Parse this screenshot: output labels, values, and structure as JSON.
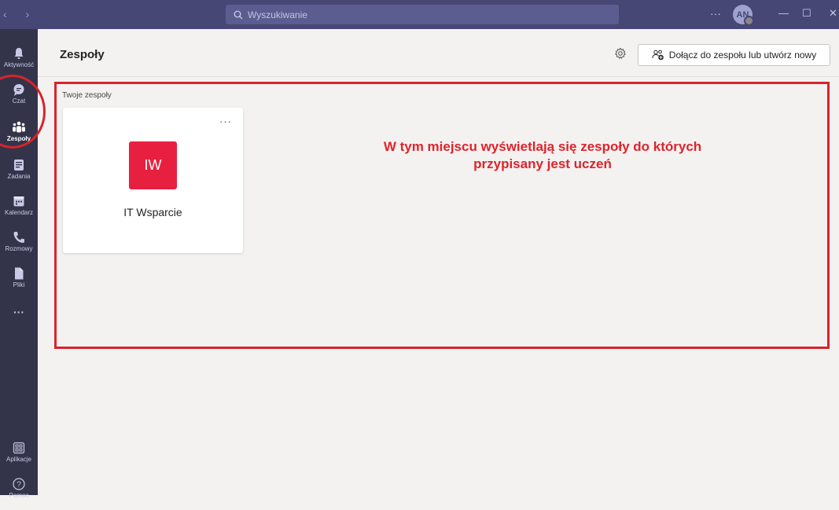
{
  "titlebar": {
    "search_placeholder": "Wyszukiwanie",
    "more": "···",
    "avatar_initials": "AN"
  },
  "rail": {
    "items": [
      {
        "label": "Aktywność",
        "icon": "bell-icon"
      },
      {
        "label": "Czat",
        "icon": "chat-icon"
      },
      {
        "label": "Zespoły",
        "icon": "teams-icon"
      },
      {
        "label": "Zadania",
        "icon": "assignments-icon"
      },
      {
        "label": "Kalendarz",
        "icon": "calendar-icon"
      },
      {
        "label": "Rozmowy",
        "icon": "phone-icon"
      },
      {
        "label": "Pliki",
        "icon": "file-icon"
      }
    ],
    "more": "···",
    "apps_label": "Aplikacje",
    "help_label": "Pomoc"
  },
  "header": {
    "title": "Zespoły",
    "join_button": "Dołącz do zespołu lub utwórz nowy"
  },
  "teams": {
    "section_label": "Twoje zespoły",
    "cards": [
      {
        "initials": "IW",
        "name": "IT Wsparcie",
        "color": "#e8203f",
        "more": "···"
      }
    ]
  },
  "annotation": {
    "line1": "W tym miejscu wyświetlają się zespoły do których",
    "line2": "przypisany jest uczeń"
  },
  "colors": {
    "titlebar": "#464775",
    "rail": "#33344a",
    "accent_red": "#d8232a"
  }
}
